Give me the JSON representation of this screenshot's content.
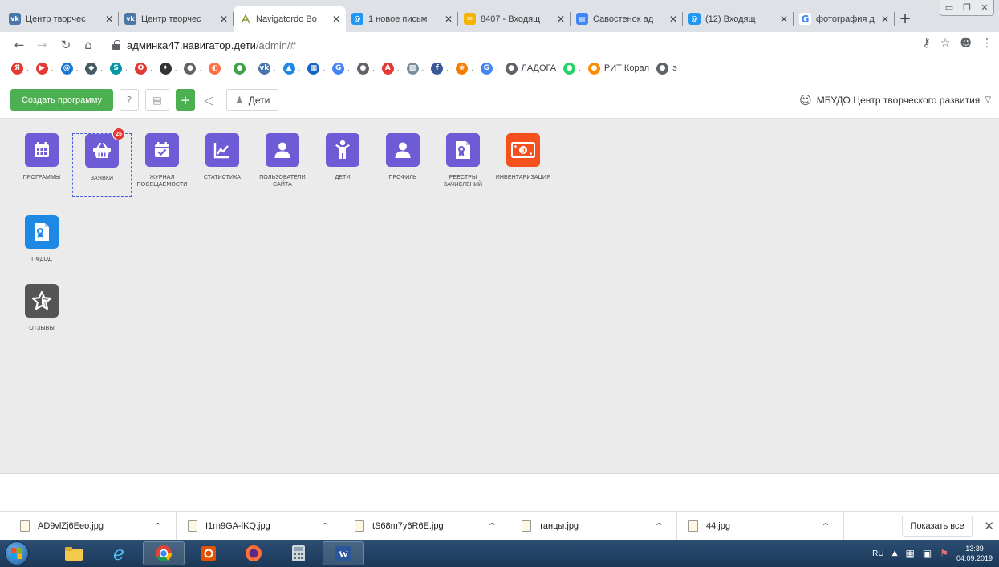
{
  "browser": {
    "tabs": [
      {
        "title": "Центр творчес",
        "fav_color": "#4a76a8",
        "fav_text": "vk"
      },
      {
        "title": "Центр творчес",
        "fav_color": "#4a76a8",
        "fav_text": "vk"
      },
      {
        "title": "Navigatordo Bo",
        "fav_color": "#ffffff",
        "fav_text": "",
        "active": true
      },
      {
        "title": "1 новое письм",
        "fav_color": "#2196f3",
        "fav_text": "@"
      },
      {
        "title": "8407 - Входящ",
        "fav_color": "#f5b400",
        "fav_text": "✉"
      },
      {
        "title": "Савостенок ад",
        "fav_color": "#4285f4",
        "fav_text": "▤"
      },
      {
        "title": "(12) Входящ",
        "fav_color": "#2196f3",
        "fav_text": "@"
      },
      {
        "title": "фотография д",
        "fav_color": "#ffffff",
        "fav_text": "G"
      }
    ],
    "url_host": "админка47.навигатор.дети",
    "url_path": "/admin/#",
    "bookmarks": [
      {
        "icon": "Я",
        "color": "#e53935",
        "label": ""
      },
      {
        "icon": "▶",
        "color": "#e53935",
        "label": ""
      },
      {
        "icon": "@",
        "color": "#1976d2",
        "label": ""
      },
      {
        "icon": "◆",
        "color": "#455a64",
        "label": ""
      },
      {
        "icon": "S",
        "color": "#0097a7",
        "label": ""
      },
      {
        "icon": "O",
        "color": "#e53935",
        "label": ""
      },
      {
        "icon": "✦",
        "color": "#333333",
        "label": ""
      },
      {
        "icon": "●",
        "color": "#5f6368",
        "label": ""
      },
      {
        "icon": "◐",
        "color": "#ff7043",
        "label": ""
      },
      {
        "icon": "●",
        "color": "#43a047",
        "label": ""
      },
      {
        "icon": "vk",
        "color": "#4a76a8",
        "label": ""
      },
      {
        "icon": "▲",
        "color": "#1e88e5",
        "label": ""
      },
      {
        "icon": "▦",
        "color": "#1565c0",
        "label": ""
      },
      {
        "icon": "G",
        "color": "#4285f4",
        "label": ""
      },
      {
        "icon": "●",
        "color": "#5f6368",
        "label": ""
      },
      {
        "icon": "A",
        "color": "#e53935",
        "label": ""
      },
      {
        "icon": "▩",
        "color": "#78909c",
        "label": ""
      },
      {
        "icon": "f",
        "color": "#3b5998",
        "label": ""
      },
      {
        "icon": "❀",
        "color": "#f57c00",
        "label": ""
      },
      {
        "icon": "G",
        "color": "#4285f4",
        "label": ""
      },
      {
        "icon": "●",
        "color": "#5f6368",
        "label": "ЛАДОГА"
      },
      {
        "icon": "●",
        "color": "#25d366",
        "label": ""
      },
      {
        "icon": "●",
        "color": "#fb8c00",
        "label": "РИТ Корал"
      },
      {
        "icon": "●",
        "color": "#5f6368",
        "label": "э"
      }
    ]
  },
  "header": {
    "create_label": "Создать программу",
    "kids_label": "Дети",
    "org_label": "МБУДО Центр творческого развития"
  },
  "tiles": [
    {
      "label": "ПРОГРАММЫ",
      "color": "#6e5bd6",
      "icon": "calendar"
    },
    {
      "label": "ЗАЯВКИ",
      "color": "#6e5bd6",
      "icon": "basket",
      "badge": "25"
    },
    {
      "label": "ЖУРНАЛ ПОСЕЩАЕМОСТИ",
      "color": "#6e5bd6",
      "icon": "calendar-check"
    },
    {
      "label": "СТАТИСТИКА",
      "color": "#6e5bd6",
      "icon": "chart"
    },
    {
      "label": "ПОЛЬЗОВАТЕЛИ САЙТА",
      "color": "#6e5bd6",
      "icon": "user"
    },
    {
      "label": "ДЕТИ",
      "color": "#6e5bd6",
      "icon": "child"
    },
    {
      "label": "ПРОФИЛЬ",
      "color": "#6e5bd6",
      "icon": "user"
    },
    {
      "label": "РЕЕСТРЫ ЗАЧИСЛЕНИЙ",
      "color": "#6e5bd6",
      "icon": "certificate"
    },
    {
      "label": "ИНВЕНТАРИЗАЦИЯ",
      "color": "#f4511e",
      "icon": "money"
    },
    {
      "label": "ПФДОД",
      "color": "#1e88e5",
      "icon": "certificate"
    },
    {
      "label": "ОТЗЫВЫ",
      "color": "#555555",
      "icon": "star"
    }
  ],
  "downloads": [
    {
      "name": "AD9vlZj6Eeo.jpg"
    },
    {
      "name": "I1rn9GA-lKQ.jpg"
    },
    {
      "name": "tS68m7y6R6E.jpg"
    },
    {
      "name": "танцы.jpg"
    },
    {
      "name": "44.jpg"
    }
  ],
  "show_all_label": "Показать все",
  "taskbar": {
    "lang": "RU",
    "time": "13:39",
    "date": "04.09.2019"
  }
}
